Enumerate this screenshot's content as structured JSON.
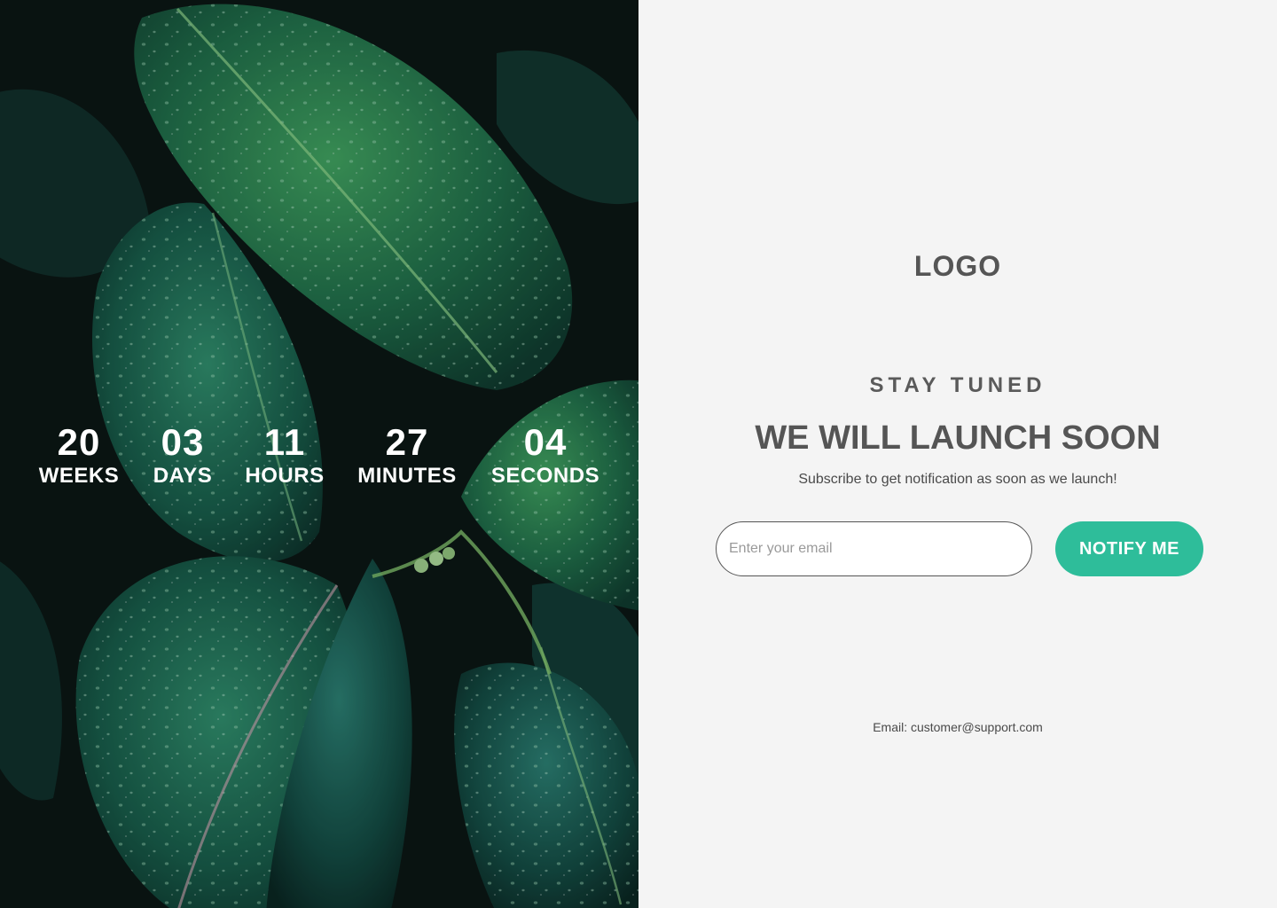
{
  "hero": {
    "image": "dark-green-wet-leaves-photo",
    "countdown": [
      {
        "value": "20",
        "label": "WEEKS"
      },
      {
        "value": "03",
        "label": "DAYS"
      },
      {
        "value": "11",
        "label": "HOURS"
      },
      {
        "value": "27",
        "label": "MINUTES"
      },
      {
        "value": "04",
        "label": "SECONDS"
      }
    ]
  },
  "panel": {
    "logo": "LOGO",
    "eyebrow": "STAY TUNED",
    "headline": "WE WILL LAUNCH SOON",
    "subtext": "Subscribe to get notification as soon as we launch!",
    "email_placeholder": "Enter your email",
    "email_value": "",
    "notify_label": "NOTIFY ME",
    "contact": "Email: customer@support.com"
  },
  "colors": {
    "accent": "#2ebd9a",
    "panel_bg": "#f4f4f4",
    "text": "#555555",
    "hero_text": "#ffffff"
  }
}
